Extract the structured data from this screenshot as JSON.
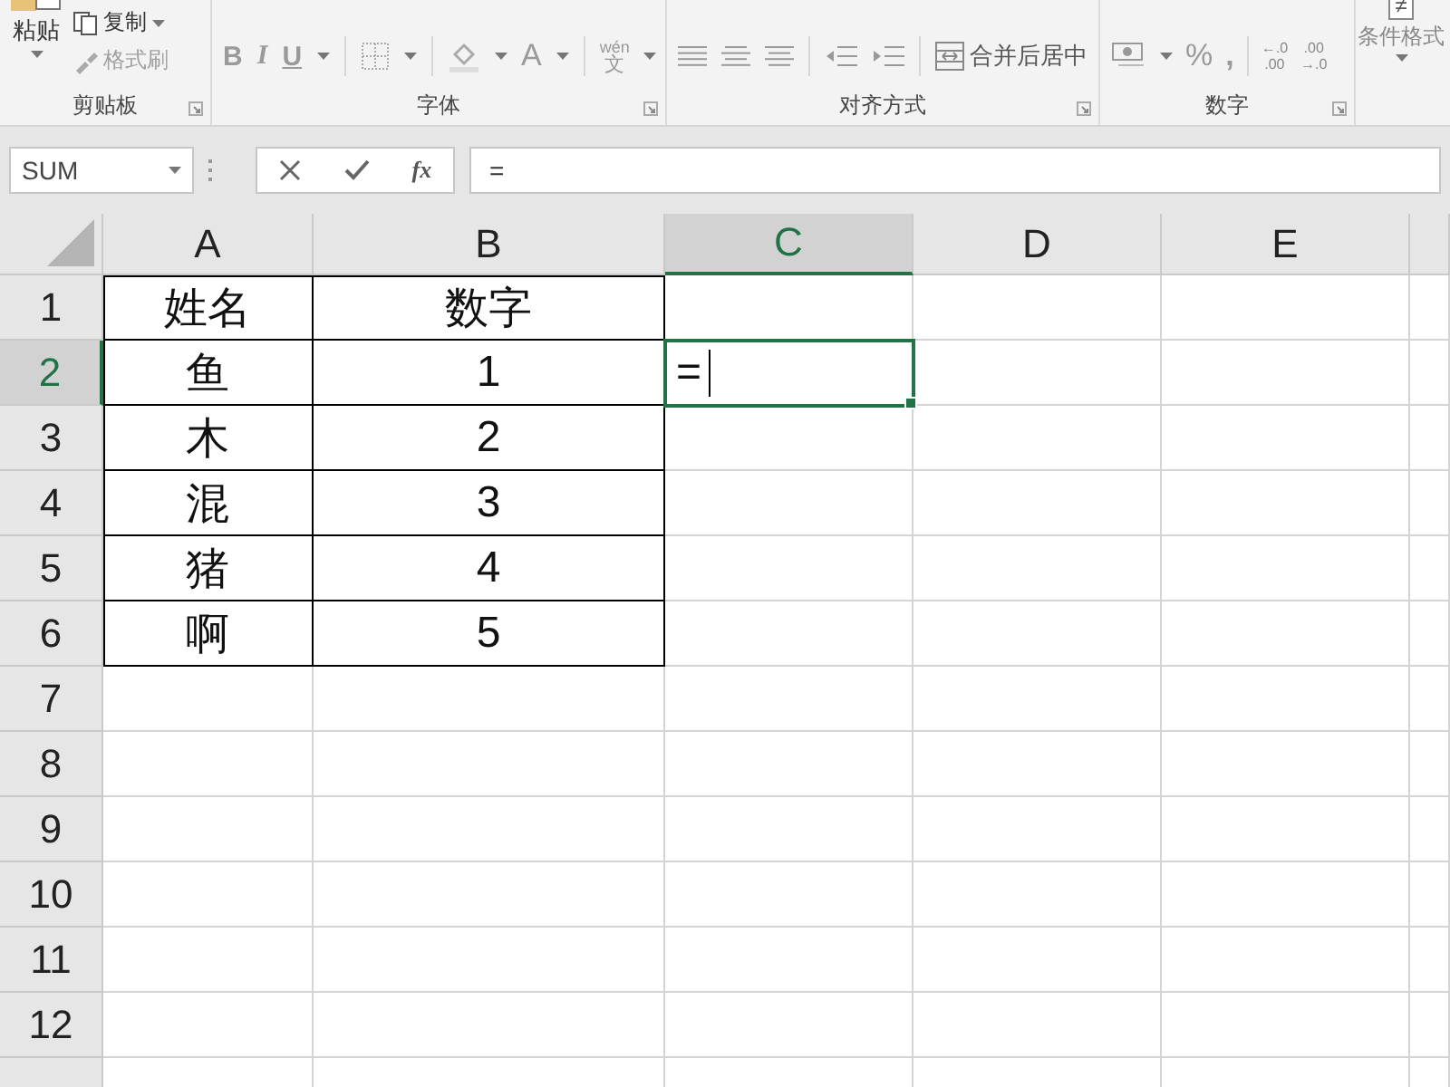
{
  "ribbon": {
    "groups": [
      {
        "kind": "clipboard",
        "label": "剪贴板",
        "buttons": [
          {
            "label": "粘贴",
            "disabled": false
          },
          {
            "label": "复制",
            "disabled": false
          },
          {
            "label": "格式刷",
            "disabled": true
          }
        ]
      },
      {
        "kind": "font",
        "label": "字体",
        "buttons": [
          {
            "label": "B"
          },
          {
            "label": "I"
          },
          {
            "label": "U"
          },
          {
            "label": "A"
          },
          {
            "label": "wén"
          },
          {
            "label": "文"
          }
        ]
      },
      {
        "kind": "alignment",
        "label": "对齐方式",
        "buttons": [
          {
            "label": "合并后居中"
          }
        ]
      },
      {
        "kind": "number",
        "label": "数字",
        "buttons": [
          {
            "label": "%"
          },
          {
            "label": ","
          },
          {
            "label": "←.0"
          },
          {
            "label": ".00"
          },
          {
            "label": ".00"
          },
          {
            "label": "→.0"
          }
        ]
      },
      {
        "kind": "styles",
        "buttons": [
          {
            "label": "≠"
          },
          {
            "label": "条件格式"
          }
        ]
      }
    ]
  },
  "formula_bar": {
    "name_box": "SUM",
    "function_label": "fx",
    "formula": "="
  },
  "sheet": {
    "columns": [
      {
        "label": "A",
        "selected": false
      },
      {
        "label": "B",
        "selected": false
      },
      {
        "label": "C",
        "selected": true
      },
      {
        "label": "D",
        "selected": false
      },
      {
        "label": "E",
        "selected": false
      }
    ],
    "rows": [
      {
        "label": "1",
        "selected": false,
        "cells": [
          "姓名",
          "数字"
        ]
      },
      {
        "label": "2",
        "selected": true,
        "cells": [
          "鱼",
          "1",
          "="
        ]
      },
      {
        "label": "3",
        "selected": false,
        "cells": [
          "木",
          "2"
        ]
      },
      {
        "label": "4",
        "selected": false,
        "cells": [
          "混",
          "3"
        ]
      },
      {
        "label": "5",
        "selected": false,
        "cells": [
          "猪",
          "4"
        ]
      },
      {
        "label": "6",
        "selected": false,
        "cells": [
          "啊",
          "5"
        ]
      },
      {
        "label": "7",
        "selected": false,
        "cells": []
      },
      {
        "label": "8",
        "selected": false,
        "cells": []
      },
      {
        "label": "9",
        "selected": false,
        "cells": []
      },
      {
        "label": "10",
        "selected": false,
        "cells": []
      },
      {
        "label": "11",
        "selected": false,
        "cells": []
      },
      {
        "label": "12",
        "selected": false,
        "cells": []
      }
    ]
  }
}
